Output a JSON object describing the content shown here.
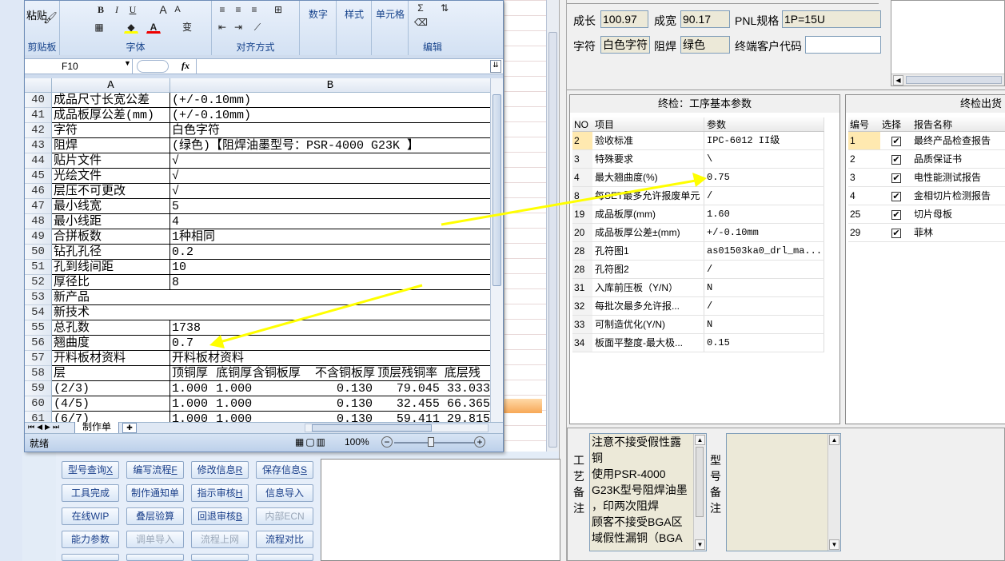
{
  "excel": {
    "ribbon": {
      "clipboard": {
        "paste": "粘贴",
        "group": "剪贴板"
      },
      "font": {
        "bold": "B",
        "italic": "I",
        "underline": "U",
        "grow": "A",
        "shrink": "A",
        "color_a": "A",
        "wen": "变",
        "group": "字体"
      },
      "align": {
        "group": "对齐方式"
      },
      "number": {
        "label": "数字"
      },
      "style": {
        "label": "样式"
      },
      "cells": {
        "label": "单元格"
      },
      "edit": {
        "group": "编辑"
      }
    },
    "name_box": "F10",
    "fx": "fx",
    "columns": [
      "A",
      "B"
    ],
    "rows": [
      {
        "n": "40",
        "a": "成品尺寸长宽公差",
        "b": "(+/-0.10mm)"
      },
      {
        "n": "41",
        "a": "成品板厚公差(mm)",
        "b": "(+/-0.10mm)"
      },
      {
        "n": "42",
        "a": "字符",
        "b": "白色字符"
      },
      {
        "n": "43",
        "a": "阻焊",
        "b": "(绿色)【阻焊油墨型号：PSR-4000 G23K 】"
      },
      {
        "n": "44",
        "a": "贴片文件",
        "b": "√"
      },
      {
        "n": "45",
        "a": "光绘文件",
        "b": "√"
      },
      {
        "n": "46",
        "a": "层压不可更改",
        "b": "√"
      },
      {
        "n": "47",
        "a": "最小线宽",
        "b": "5"
      },
      {
        "n": "48",
        "a": "最小线距",
        "b": "4"
      },
      {
        "n": "49",
        "a": "合拼板数",
        "b": "1种相同"
      },
      {
        "n": "50",
        "a": "钻孔孔径",
        "b": "0.2"
      },
      {
        "n": "51",
        "a": "孔到线间距",
        "b": "10"
      },
      {
        "n": "52",
        "a": "厚径比",
        "b": "8"
      },
      {
        "n": "53",
        "a": "新产品",
        "b": ""
      },
      {
        "n": "54",
        "a": "新技术",
        "b": ""
      },
      {
        "n": "55",
        "a": "总孔数",
        "b": "1738"
      },
      {
        "n": "56",
        "a": "翘曲度",
        "b": "0.7"
      },
      {
        "n": "57",
        "a": "开料板材资料",
        "b": "开料板材资料"
      }
    ],
    "sub_rows": [
      {
        "n": "58",
        "a": "层",
        "c": [
          "顶铜厚",
          "底铜厚",
          "含铜板厚",
          "不含铜板厚",
          "顶层残铜率",
          "底层残"
        ]
      },
      {
        "n": "59",
        "a": "(2/3)",
        "c": [
          "1.000",
          "1.000",
          "",
          "0.130",
          "79.045",
          "33.033"
        ]
      },
      {
        "n": "60",
        "a": "(4/5)",
        "c": [
          "1.000",
          "1.000",
          "",
          "0.130",
          "32.455",
          "66.365"
        ]
      },
      {
        "n": "61",
        "a": "(6/7)",
        "c": [
          "1.000",
          "1.000",
          "",
          "0.130",
          "59.411",
          "29.815"
        ]
      }
    ],
    "sheet_tab": "制作单",
    "status": {
      "ready": "就绪",
      "zoom": "100%"
    }
  },
  "buttons": [
    {
      "label": "型号查询",
      "key": "X",
      "disabled": false
    },
    {
      "label": "编写流程",
      "key": "F",
      "disabled": false
    },
    {
      "label": "修改信息",
      "key": "R",
      "disabled": false
    },
    {
      "label": "保存信息",
      "key": "S",
      "disabled": false
    },
    {
      "label": "工具完成",
      "key": "",
      "disabled": false
    },
    {
      "label": "制作通知单",
      "key": "",
      "disabled": false
    },
    {
      "label": "指示审核",
      "key": "H",
      "disabled": false
    },
    {
      "label": "信息导入",
      "key": "",
      "disabled": false
    },
    {
      "label": "在线WIP",
      "key": "",
      "disabled": false
    },
    {
      "label": "叠层验算",
      "key": "",
      "disabled": false
    },
    {
      "label": "回退审核",
      "key": "B",
      "disabled": false
    },
    {
      "label": "内部ECN",
      "key": "",
      "disabled": true
    },
    {
      "label": "能力参数",
      "key": "",
      "disabled": false
    },
    {
      "label": "调单导入",
      "key": "",
      "disabled": true
    },
    {
      "label": "流程上网",
      "key": "",
      "disabled": true
    },
    {
      "label": "流程对比",
      "key": "",
      "disabled": false
    }
  ],
  "info": {
    "len_label": "成长",
    "len_val": "100.97",
    "wid_label": "成宽",
    "wid_val": "90.17",
    "pnl_label": "PNL规格",
    "pnl_val": "1P=15U",
    "char_label": "字符",
    "char_val": "白色字符",
    "mask_label": "阻焊",
    "mask_val": "绿色",
    "cust_label": "终端客户代码",
    "cust_val": ""
  },
  "final_params": {
    "title": "终检：工序基本参数",
    "headers": [
      "NO",
      "项目",
      "参数"
    ],
    "rows": [
      {
        "no": "2",
        "item": "验收标准",
        "val": "IPC-6012 II级"
      },
      {
        "no": "3",
        "item": "特殊要求",
        "val": "\\"
      },
      {
        "no": "4",
        "item": "最大翘曲度(%)",
        "val": "0.75"
      },
      {
        "no": "8",
        "item": "每SET最多允许报废单元",
        "val": "/"
      },
      {
        "no": "19",
        "item": "成品板厚(mm)",
        "val": "1.60"
      },
      {
        "no": "20",
        "item": "成品板厚公差±(mm)",
        "val": "+/-0.10mm"
      },
      {
        "no": "28",
        "item": "孔符图1",
        "val": "as01503ka0_drl_ma..."
      },
      {
        "no": "28",
        "item": "孔符图2",
        "val": "/"
      },
      {
        "no": "31",
        "item": "入库前压板（Y/N）",
        "val": "N"
      },
      {
        "no": "32",
        "item": "每批次最多允许报...",
        "val": "/"
      },
      {
        "no": "33",
        "item": "可制造优化(Y/N)",
        "val": "N"
      },
      {
        "no": "34",
        "item": "板面平整度-最大极...",
        "val": "0.15"
      }
    ]
  },
  "reports": {
    "title": "终检出货",
    "headers": [
      "编号",
      "选择",
      "报告名称"
    ],
    "rows": [
      {
        "no": "1",
        "checked": "✔",
        "name": "最终产品检查报告"
      },
      {
        "no": "2",
        "checked": "✔",
        "name": "品质保证书"
      },
      {
        "no": "3",
        "checked": "✔",
        "name": "电性能测试报告"
      },
      {
        "no": "4",
        "checked": "✔",
        "name": "金相切片检测报告"
      },
      {
        "no": "25",
        "checked": "✔",
        "name": "切片母板"
      },
      {
        "no": "29",
        "checked": "✔",
        "name": "菲林"
      }
    ]
  },
  "notes": {
    "process_label": [
      "工",
      "艺",
      "备",
      "注"
    ],
    "process_lines": [
      "注意不接受假性露",
      "铜",
      "使用PSR-4000",
      "G23K型号阻焊油墨",
      "，印两次阻焊",
      "顾客不接受BGA区",
      "域假性漏铜（BGA"
    ],
    "model_label": [
      "型",
      "号",
      "备",
      "注"
    ]
  },
  "colors": {
    "accent": "#15428b",
    "highlight": "#ffe9b0",
    "arrow": "#ffff00"
  }
}
